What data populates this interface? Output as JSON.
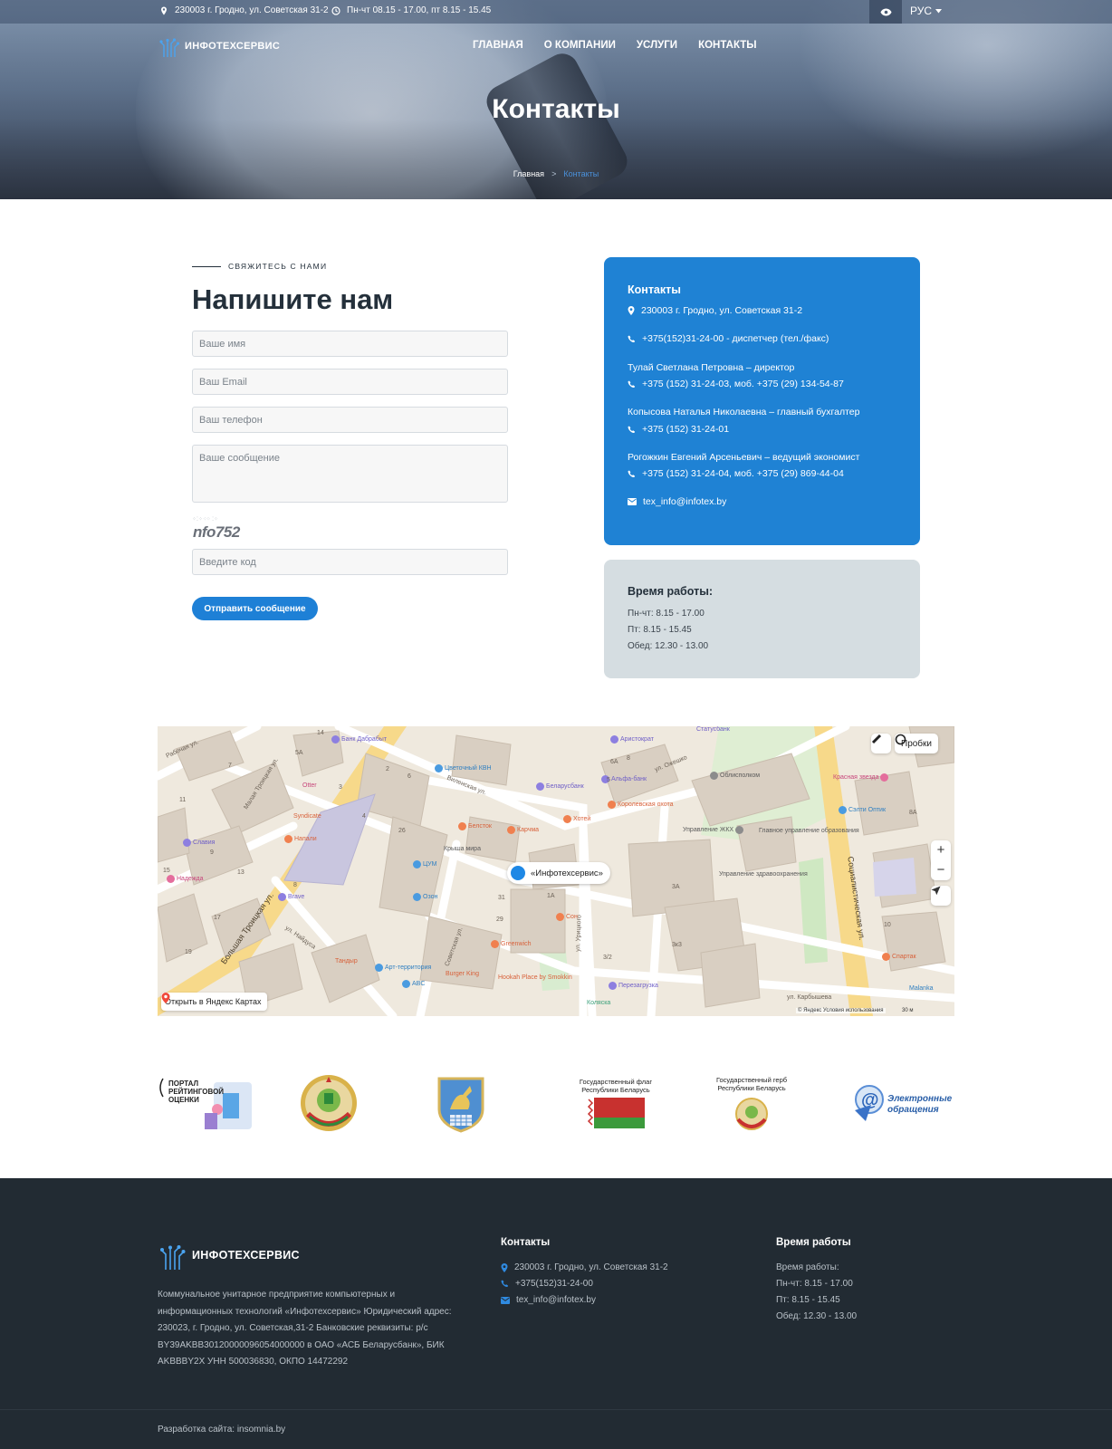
{
  "topbar": {
    "address": "230003 г. Гродно, ул. Советская 31-2",
    "hours": "Пн-чт 08.15 - 17.00, пт 8.15 - 15.45",
    "language": "РУС"
  },
  "header": {
    "logo_text": "ИНФОТЕХСЕРВИС",
    "nav": [
      "ГЛАВНАЯ",
      "О КОМПАНИИ",
      "УСЛУГИ",
      "КОНТАКТЫ"
    ]
  },
  "hero": {
    "title": "Контакты",
    "breadcrumb": {
      "home": "Главная",
      "separator": ">",
      "current": "Контакты"
    }
  },
  "form": {
    "eyebrow": "СВЯЖИТЕСЬ С НАМИ",
    "title": "Напишите нам",
    "name_placeholder": "Ваше имя",
    "email_placeholder": "Ваш Email",
    "phone_placeholder": "Ваш телефон",
    "message_placeholder": "Ваше сообщение",
    "captcha_code": "nfo752",
    "captcha_placeholder": "Введите код",
    "submit_label": "Отправить сообщение"
  },
  "contacts_card": {
    "title": "Контакты",
    "address": "230003 г. Гродно, ул. Советская 31-2",
    "dispatcher": "+375(152)31-24-00 - диспетчер (тел./факс)",
    "director_name": "Тулай Светлана Петровна – директор",
    "director_phone": "+375 (152) 31-24-03, моб. +375 (29) 134-54-87",
    "accountant_name": "Копысова Наталья Николаевна – главный бухгалтер",
    "accountant_phone": "+375 (152) 31-24-01",
    "economist_name": "Рогожкин Евгений Арсеньевич – ведущий экономист",
    "economist_phone": "+375 (152) 31-24-04, моб. +375 (29) 869-44-04",
    "email": "tex_info@infotex.by"
  },
  "hours_card": {
    "title": "Время работы:",
    "lines": [
      "Пн-чт: 8.15 - 17.00",
      "Пт: 8.15 - 15.45",
      "Обед: 12.30 - 13.00"
    ]
  },
  "map": {
    "place_label": "«Инфотехсервис»",
    "traffic_label": "Пробки",
    "open_label": "Открыть в Яндекс Картах",
    "copyright": "© Яндекс   Условия использования",
    "scale": "30 м",
    "zoom_in": "+",
    "zoom_out": "−",
    "streets": [
      "Рабочая ул.",
      "Малая Троицкая ул.",
      "Большая Троицкая ул.",
      "Виленская ул.",
      "ул. Ожешко",
      "Социалистическая ул.",
      "ул. Урицкого",
      "Советская ул.",
      "ул. Карбышева",
      "ул. Найдуса"
    ],
    "pois": [
      "Банк Дабрабыт",
      "Цветочный КВН",
      "Аристократ",
      "Статусбанк",
      "Альфа-банк",
      "Облисполком",
      "Беларусбанк",
      "Королевская охота",
      "Красная звезда",
      "Сэлти Оптик",
      "Otter",
      "Syndicate",
      "Напали",
      "Славия",
      "Надежда",
      "Brave",
      "ЦУМ",
      "Озон",
      "Белсток",
      "Карчма",
      "Хотей",
      "Крыша мира",
      "Управление ЖКХ",
      "Главное управление образования",
      "Управление здравоохранения",
      "Сон",
      "Greenwich",
      "Арт-территория",
      "ABC",
      "Burger King",
      "Hookah Place by Smokkin",
      "Перезагрузка",
      "Коляска",
      "Тандыр",
      "Спартак",
      "Malanka"
    ],
    "house_numbers": [
      "14",
      "5А",
      "7",
      "6А",
      "8",
      "2",
      "6",
      "4",
      "11",
      "3",
      "9",
      "13",
      "17",
      "15",
      "19",
      "26",
      "10",
      "1А",
      "31",
      "29",
      "3А",
      "3к3",
      "3/2",
      "8А",
      "5",
      "8"
    ]
  },
  "partners": {
    "rating_portal": [
      "ПОРТАЛ",
      "РЕЙТИНГОВОЙ",
      "ОЦЕНКИ"
    ],
    "flag_caption": [
      "Государственный флаг",
      "Республики Беларусь"
    ],
    "emblem_caption": [
      "Государственный герб",
      "Республики Беларусь"
    ],
    "appeals": [
      "Электронные",
      "обращения"
    ]
  },
  "footer": {
    "logo_text": "ИНФОТЕХСЕРВИС",
    "about": "Коммунальное унитарное предприятие компьютерных и информационных технологий «Инфотехсервис» Юридический адрес: 230023, г. Гродно, ул. Советская,31-2 Банковские реквизиты: р/с BY39AKBB30120000096054000000 в ОАО «АСБ Беларусбанк», БИК AKBBBY2X УНН 500036830, ОКПО 14472292",
    "contacts_title": "Контакты",
    "address": "230003 г. Гродно, ул. Советская 31-2",
    "phone": "+375(152)31-24-00",
    "email": "tex_info@infotex.by",
    "hours_title": "Время работы",
    "hours_lines": [
      "Время работы:",
      "Пн-чт: 8.15 - 17.00",
      "Пт: 8.15 - 15.45",
      "Обед: 12.30 - 13.00"
    ],
    "developer": "Разработка сайта: insomnia.by"
  },
  "colors": {
    "accent": "#1f82d4",
    "footer_bg": "#222b33",
    "hours_card_bg": "#d5dde1",
    "heading": "#24303b"
  },
  "icons": [
    "map-pin-icon",
    "clock-icon",
    "eye-icon",
    "chevron-down-icon",
    "phone-icon",
    "mail-icon",
    "ruler-icon",
    "traffic-icon",
    "locate-icon"
  ]
}
